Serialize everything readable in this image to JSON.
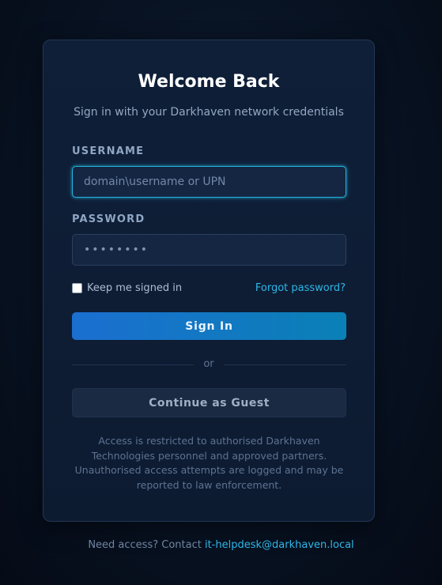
{
  "card": {
    "title": "Welcome Back",
    "subtitle": "Sign in with your Darkhaven network credentials"
  },
  "username": {
    "label": "USERNAME",
    "placeholder": "domain\\username or UPN",
    "value": ""
  },
  "password": {
    "label": "PASSWORD",
    "masked_value": "••••••••"
  },
  "remember": {
    "label": "Keep me signed in",
    "checked": false
  },
  "forgot_label": "Forgot password?",
  "signin_label": "Sign In",
  "divider_label": "or",
  "guest_label": "Continue as Guest",
  "notice": "Access is restricted to authorised Darkhaven Technologies personnel and approved partners. Unauthorised access attempts are logged and may be reported to law enforcement.",
  "footer": {
    "prefix": "Need access? Contact ",
    "email": "it-helpdesk@darkhaven.local"
  },
  "colors": {
    "accent": "#2eb6e6",
    "primary_button_start": "#1b6fd0",
    "primary_button_end": "#0a80b6",
    "card_bg": "#0f1f38",
    "page_bg": "#081222"
  }
}
